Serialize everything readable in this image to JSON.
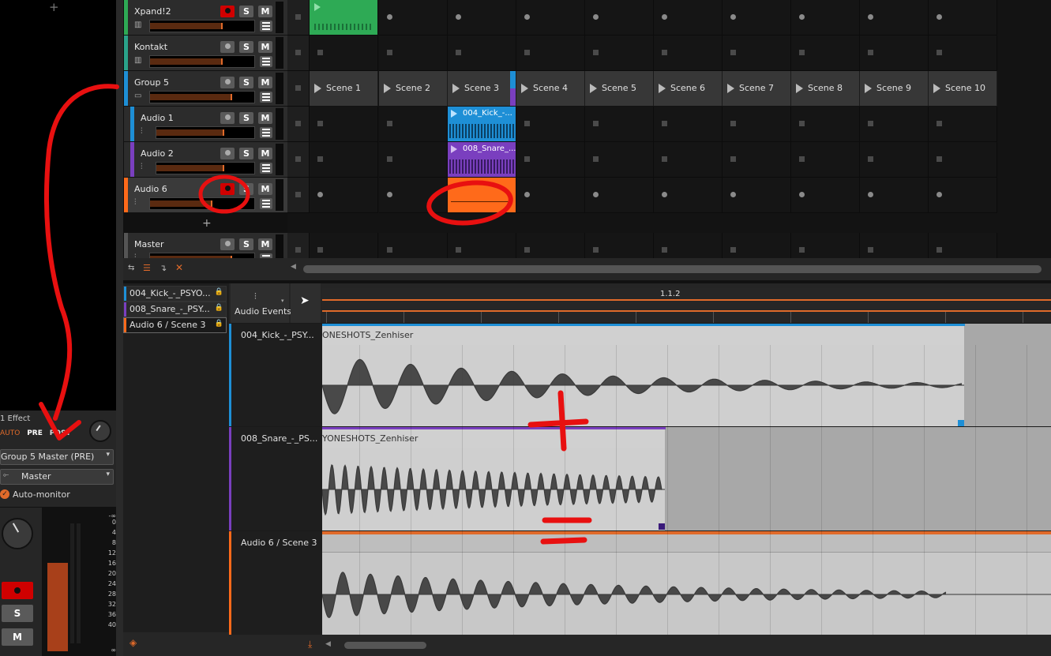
{
  "colors": {
    "accent": "#e06a2a",
    "record": "#d00000",
    "annotation": "#e81010",
    "clip_blue": "#1e8fd6",
    "clip_purple": "#7a3fbf",
    "clip_green": "#2eaa55",
    "clip_orange": "#ff6a1a"
  },
  "left_panel": {
    "effect_count": "1 Effect",
    "mode_tabs": [
      "AUTO",
      "PRE",
      "POST"
    ],
    "source_select": "Group 5 Master (PRE)",
    "output_select": "Master",
    "auto_monitor_label": "Auto-monitor",
    "meter_scale": [
      "-∞",
      "0",
      "4",
      "8",
      "12",
      "16",
      "20",
      "24",
      "28",
      "32",
      "36",
      "40",
      "∞"
    ],
    "solo_label": "S",
    "mute_label": "M",
    "add_label": "+"
  },
  "tracks": [
    {
      "name": "Xpand!2",
      "color": "#2eaa55",
      "solo": "S",
      "mute": "M",
      "armed": true,
      "level": 0.7
    },
    {
      "name": "Kontakt",
      "color": "#2aa38a",
      "solo": "S",
      "mute": "M",
      "armed": false,
      "level": 0.7
    },
    {
      "name": "Group 5",
      "color": "#1e8fd6",
      "solo": "S",
      "mute": "M",
      "armed": false,
      "level": 0.8
    },
    {
      "name": "Audio 1",
      "color": "#1e8fd6",
      "solo": "S",
      "mute": "M",
      "armed": false,
      "level": 0.7
    },
    {
      "name": "Audio 2",
      "color": "#7a3fbf",
      "solo": "S",
      "mute": "M",
      "armed": false,
      "level": 0.7
    },
    {
      "name": "Audio 6",
      "color": "#ff6a1a",
      "solo": "S",
      "mute": "M",
      "armed": true,
      "level": 0.6
    },
    {
      "name": "Master",
      "color": "#555555",
      "solo": "S",
      "mute": "M",
      "armed": false,
      "level": 0.8
    }
  ],
  "add_track_label": "+",
  "scenes": [
    "Scene 1",
    "Scene 2",
    "Scene 3",
    "Scene 4",
    "Scene 5",
    "Scene 6",
    "Scene 7",
    "Scene 8",
    "Scene 9",
    "Scene 10"
  ],
  "clips": [
    {
      "track": "Audio 1",
      "scene": "Scene 3",
      "name": "004_Kick_-..."
    },
    {
      "track": "Audio 2",
      "scene": "Scene 3",
      "name": "008_Snare_..."
    }
  ],
  "editor": {
    "list": [
      {
        "name": "004_Kick_-_PSYO...",
        "color": "#1e8fd6"
      },
      {
        "name": "008_Snare_-_PSY...",
        "color": "#7a3fbf"
      },
      {
        "name": "Audio 6 / Scene 3",
        "color": "#ff6a1a"
      }
    ],
    "tool_label": "Audio Events",
    "ruler_mark": "1.1.2",
    "lanes": [
      {
        "label": "004_Kick_-_PSY...",
        "clip_title": "ONESHOTS_Zenhiser",
        "color": "#1e8fd6"
      },
      {
        "label": "008_Snare_-_PS...",
        "clip_title": "YONESHOTS_Zenhiser",
        "color": "#7a3fbf"
      },
      {
        "label": "Audio 6 / Scene 3",
        "clip_title": "",
        "color": "#ff6a1a"
      }
    ]
  },
  "annotations": {
    "plus_sign": "+",
    "minus_sign": "="
  }
}
